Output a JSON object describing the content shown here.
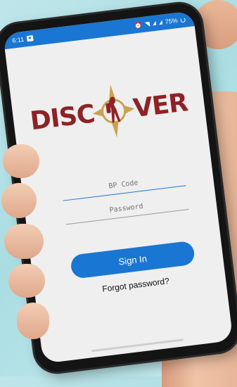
{
  "statusbar": {
    "time": "6:11",
    "battery": "75%"
  },
  "logo": {
    "part1": "DISC",
    "part2": "VER"
  },
  "login": {
    "bp_code_placeholder": "BP Code",
    "password_placeholder": "Password",
    "signin_label": "Sign In",
    "forgot_label": "Forgot password?"
  },
  "colors": {
    "accent": "#1976d2",
    "brand": "#8e2226",
    "gold": "#c9a450"
  },
  "icons": [
    "notification-icon",
    "alarm-icon",
    "wifi-icon",
    "signal-icon",
    "battery-icon",
    "compass-logo-icon"
  ]
}
